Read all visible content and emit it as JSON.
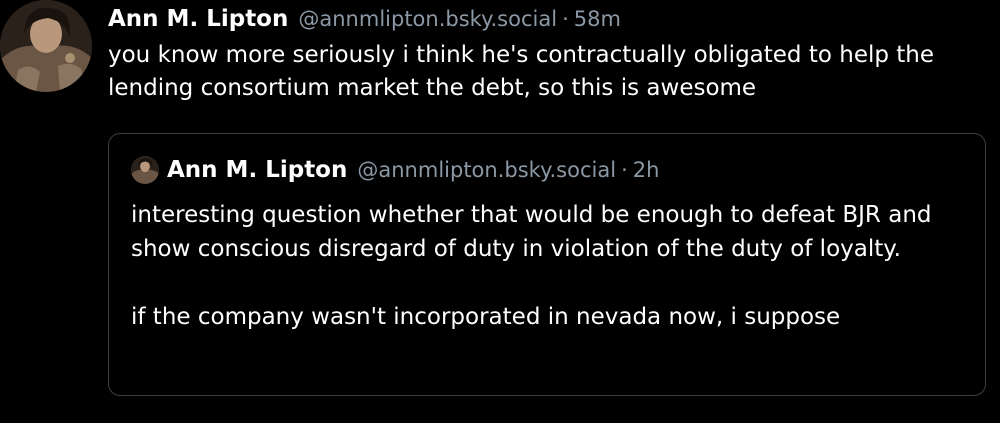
{
  "post": {
    "author_name": "Ann M. Lipton",
    "handle": "@annmlipton.bsky.social",
    "separator": "·",
    "time": "58m",
    "text": "you know more seriously i think he's contractually obligated to help the lending consortium market the debt, so this is awesome",
    "avatar_icon": "user-avatar-icon"
  },
  "quote": {
    "author_name": "Ann M. Lipton",
    "handle": "@annmlipton.bsky.social",
    "separator": "·",
    "time": "2h",
    "text": "interesting question whether that would be enough to defeat BJR and show conscious disregard of duty in violation of the duty of loyalty.\n\nif the company wasn't incorporated in nevada now, i suppose",
    "avatar_icon": "user-avatar-icon"
  },
  "colors": {
    "background": "#000000",
    "text": "#ffffff",
    "muted": "#8b98a5",
    "border": "#3a3f44"
  }
}
